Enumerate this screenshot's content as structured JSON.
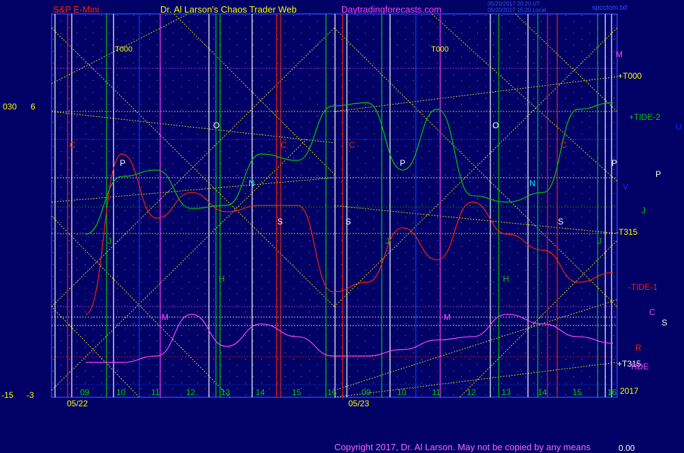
{
  "header": {
    "symbol": "S&P E-Mini",
    "title": "Dr. Al Larson's Chaos Trader Web",
    "site": "Daytradingforecasts.com",
    "timestamp_ut": "05/20/2017 20:20 UT",
    "timestamp_local": "05/20/2017 15:20 Local",
    "file": "spcctom.txt"
  },
  "left_axis": {
    "top_left": "030",
    "top_right": "6",
    "bottom_left": "-15",
    "bottom_right": "-3"
  },
  "right_value": "0.00",
  "copyright": "Copyright 2017, Dr. Al Larson. May not be copied by any means",
  "colors": {
    "background": "#000066",
    "frame": "#2244ff",
    "yellow": "#ffff00",
    "green": "#00cc00",
    "red": "#ff2200",
    "magenta": "#ff44ff",
    "white": "#ffffff",
    "cyan": "#00ffff",
    "blue": "#0033ff"
  },
  "chart_data": {
    "type": "line",
    "x": [
      "05/22 09",
      "05/22 10",
      "05/22 11",
      "05/22 12",
      "05/22 13",
      "05/22 14",
      "05/22 15",
      "05/22 16",
      "05/23 09",
      "05/23 10",
      "05/23 11",
      "05/23 12",
      "05/23 13",
      "05/23 14",
      "05/23 15",
      "05/23 16"
    ],
    "date_labels": [
      "05/22",
      "05/23"
    ],
    "hour_labels": [
      "09",
      "10",
      "11",
      "12",
      "13",
      "14",
      "15",
      "16",
      "09",
      "10",
      "11",
      "12",
      "13",
      "14",
      "15",
      "16"
    ],
    "year_label": "2017",
    "ylim": [
      -3,
      6
    ],
    "series": [
      {
        "name": "+TIDE-2",
        "values": [
          2,
          3.8,
          4,
          2.8,
          2.9,
          4.5,
          4.3,
          6,
          6.1,
          4,
          5.9,
          3.2,
          3,
          3.3,
          5.9,
          6.1
        ]
      },
      {
        "name": "-TIDE-1",
        "values": [
          -0.5,
          4.5,
          2.5,
          3.3,
          2.7,
          2.9,
          2.9,
          0.2,
          0.5,
          2.2,
          1.2,
          3,
          2,
          1.5,
          0.5,
          0.8
        ]
      },
      {
        "name": "TIDE",
        "values": [
          -2,
          -2,
          -1.8,
          -0.5,
          -1.5,
          -0.8,
          -1.2,
          -1.8,
          -1.8,
          -1.6,
          -1.3,
          -1.2,
          -0.5,
          -0.8,
          -1.2,
          -1.4
        ]
      }
    ],
    "line_labels": [
      "+T000",
      "-T315",
      "+T315"
    ],
    "top_labels": [
      "T000",
      "T000"
    ],
    "cycle_letters": [
      {
        "text": "C",
        "color": "#ff2200"
      },
      {
        "text": "P",
        "color": "#ffffff"
      },
      {
        "text": "O",
        "color": "#ffffff"
      },
      {
        "text": "N",
        "color": "#00ffff"
      },
      {
        "text": "J",
        "color": "#00cc00"
      },
      {
        "text": "H",
        "color": "#00cc00"
      },
      {
        "text": "S",
        "color": "#ffffff"
      },
      {
        "text": "C",
        "color": "#ff2200"
      },
      {
        "text": "M",
        "color": "#ff44ff"
      },
      {
        "text": "C",
        "color": "#ff2200"
      },
      {
        "text": "P",
        "color": "#ffffff"
      },
      {
        "text": "S",
        "color": "#ffffff"
      },
      {
        "text": "J",
        "color": "#00cc00"
      },
      {
        "text": "M",
        "color": "#ff44ff"
      },
      {
        "text": "O",
        "color": "#ffffff"
      },
      {
        "text": "H",
        "color": "#00cc00"
      },
      {
        "text": "N",
        "color": "#00ffff"
      },
      {
        "text": "C",
        "color": "#ff2200"
      },
      {
        "text": "S",
        "color": "#ffffff"
      },
      {
        "text": "P",
        "color": "#ffffff"
      },
      {
        "text": "J",
        "color": "#00cc00"
      }
    ],
    "right_labels": [
      {
        "text": "M",
        "color": "#ff44ff"
      },
      {
        "text": "+T000",
        "color": "#ffff00"
      },
      {
        "text": "+TIDE-2",
        "color": "#00cc00"
      },
      {
        "text": "U",
        "color": "#0033ff"
      },
      {
        "text": "P",
        "color": "#ffffff"
      },
      {
        "text": "V",
        "color": "#0033ff"
      },
      {
        "text": "J",
        "color": "#00cc00"
      },
      {
        "text": "-T315",
        "color": "#ffff00"
      },
      {
        "text": "-TIDE-1",
        "color": "#ff2200"
      },
      {
        "text": "C",
        "color": "#ff44ff"
      },
      {
        "text": "S",
        "color": "#ffffff"
      },
      {
        "text": "R",
        "color": "#ff2200"
      },
      {
        "text": "+T315",
        "color": "#ffffff"
      },
      {
        "text": "TIDE",
        "color": "#ff44ff"
      }
    ]
  }
}
